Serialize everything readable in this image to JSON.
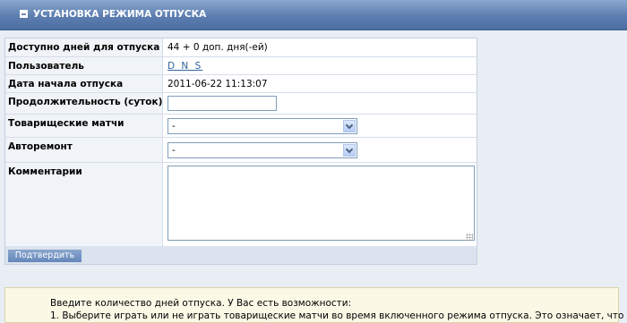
{
  "header": {
    "title": "УСТАНОВКА РЕЖИМА ОТПУСКА"
  },
  "form": {
    "rows": [
      {
        "label": "Доступно дней для отпуска",
        "value": "44 + 0 доп. дня(-ей)"
      },
      {
        "label": "Пользователь",
        "value": "D N S"
      },
      {
        "label": "Дата начала отпуска",
        "value": "2011-06-22 11:13:07"
      },
      {
        "label": "Продолжительность (суток)",
        "input_value": ""
      },
      {
        "label": "Товарищеские матчи",
        "selected": "-"
      },
      {
        "label": "Авторемонт",
        "selected": "-"
      },
      {
        "label": "Комментарии",
        "textarea_value": ""
      }
    ],
    "submit_label": "Подтвердить"
  },
  "info": {
    "line1": "Введите количество дней отпуска. У Вас есть возможности:",
    "line2": "1. Выберите играть или не играть товарищеские матчи во время включенного режима отпуска. Это означает, что"
  }
}
